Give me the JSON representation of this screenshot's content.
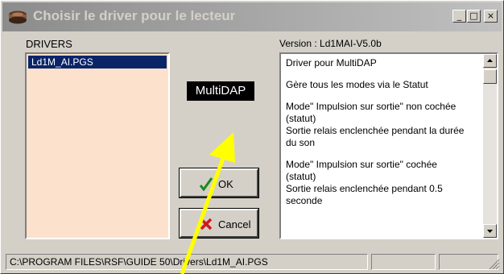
{
  "window": {
    "title": "Choisir le driver pour le lecteur",
    "minimize_glyph": "_",
    "maximize_glyph": "□",
    "close_glyph": "×"
  },
  "drivers": {
    "label": "DRIVERS",
    "items": [
      "Ld1M_AI.PGS"
    ],
    "selected_index": 0
  },
  "badge": {
    "label": "MultiDAP"
  },
  "buttons": {
    "ok_label": "OK",
    "cancel_label": "Cancel"
  },
  "info": {
    "version": "Version : Ld1MAI-V5.0b",
    "paragraphs": [
      "Driver pour MultiDAP",
      "Gère tous les modes via le Statut",
      "Mode\" Impulsion sur sortie\" non cochée (statut)\nSortie relais enclenchée pendant la durée du son",
      "Mode\" Impulsion sur sortie\" cochée (statut)\nSortie relais enclenchée pendant 0.5 seconde"
    ]
  },
  "status": {
    "path": "C:\\PROGRAM FILES\\RSF\\GUIDE 50\\Drivers\\Ld1M_AI.PGS"
  },
  "colors": {
    "list_background": "#fce2cc",
    "selection": "#0a2468",
    "annotation_arrow": "#ffff00"
  },
  "icons": {
    "title": "speaker-icon",
    "ok": "checkmark-icon",
    "cancel": "cross-icon"
  }
}
